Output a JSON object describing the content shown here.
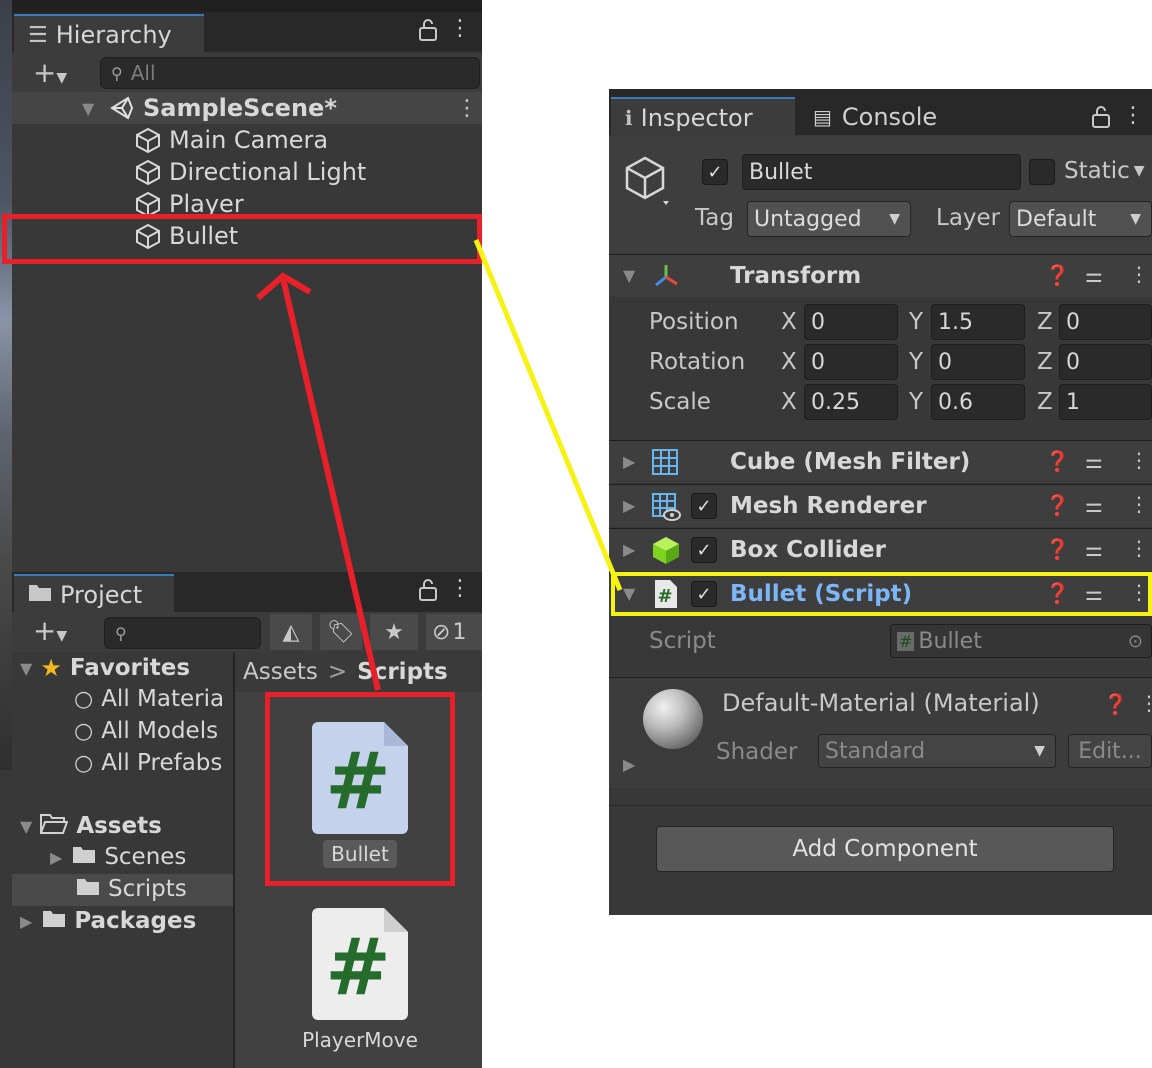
{
  "hierarchy": {
    "tab_label": "Hierarchy",
    "search_placeholder": "All",
    "scene_name": "SampleScene*",
    "objects": [
      "Main Camera",
      "Directional Light",
      "Player",
      "Bullet"
    ]
  },
  "project": {
    "tab_label": "Project",
    "hidden_count": "1",
    "favorites": {
      "label": "Favorites",
      "items": [
        "All Materia",
        "All Models",
        "All Prefabs"
      ]
    },
    "assets_label": "Assets",
    "asset_folders": [
      "Scenes",
      "Scripts"
    ],
    "packages_label": "Packages",
    "breadcrumb": [
      "Assets",
      "Scripts"
    ],
    "breadcrumb_sep": ">",
    "files": [
      "Bullet",
      "PlayerMove"
    ]
  },
  "inspector": {
    "tab_label": "Inspector",
    "console_tab_label": "Console",
    "object_name": "Bullet",
    "static_label": "Static",
    "tag_label": "Tag",
    "tag_value": "Untagged",
    "layer_label": "Layer",
    "layer_value": "Default",
    "transform": {
      "title": "Transform",
      "position_label": "Position",
      "rotation_label": "Rotation",
      "scale_label": "Scale",
      "axis_x": "X",
      "axis_y": "Y",
      "axis_z": "Z",
      "position": [
        "0",
        "1.5",
        "0"
      ],
      "rotation": [
        "0",
        "0",
        "0"
      ],
      "scale": [
        "0.25",
        "0.6",
        "1"
      ]
    },
    "components": [
      "Cube (Mesh Filter)",
      "Mesh Renderer",
      "Box Collider",
      "Bullet (Script)"
    ],
    "script_label": "Script",
    "script_value": "Bullet",
    "material_title": "Default-Material (Material)",
    "shader_label": "Shader",
    "shader_value": "Standard",
    "edit_label": "Edit...",
    "add_component_label": "Add Component"
  },
  "colors": {
    "highlight_red": "#e8202a",
    "highlight_yellow": "#f5f214",
    "script_title_blue": "#7db6f5",
    "tab_accent": "#3a79bb"
  }
}
